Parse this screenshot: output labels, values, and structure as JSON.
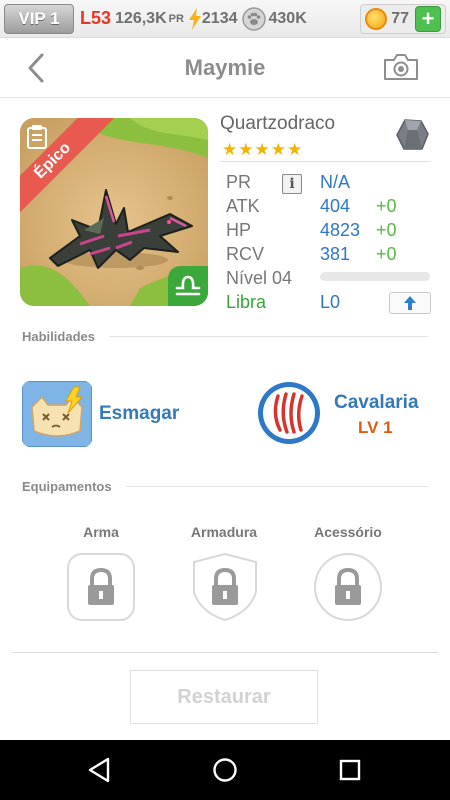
{
  "status": {
    "vip": "VIP 1",
    "level": "L53",
    "pr_value": "126,3K",
    "pr_label": "PR",
    "energy": "2134",
    "food": "430K",
    "coins": "77",
    "plus": "+"
  },
  "header": {
    "title": "Maymie"
  },
  "monster": {
    "rarity": "Épico",
    "species": "Quartzodraco",
    "stars": "★★★★★",
    "star_count": 5,
    "stats": [
      {
        "key": "PR",
        "value": "N/A",
        "bonus": ""
      },
      {
        "key": "ATK",
        "value": "404",
        "bonus": "+0"
      },
      {
        "key": "HP",
        "value": "4823",
        "bonus": "+0"
      },
      {
        "key": "RCV",
        "value": "381",
        "bonus": "+0"
      }
    ],
    "info_glyph": "i",
    "level_label": "Nível 04",
    "level_progress": 0,
    "zodiac": "Libra",
    "league": "L0"
  },
  "sections": {
    "skills": "Habilidades",
    "equipment": "Equipamentos"
  },
  "skills": {
    "active": {
      "name": "Esmagar"
    },
    "leader": {
      "name": "Cavalaria",
      "level": "LV 1"
    }
  },
  "equipment": {
    "slots": [
      {
        "label": "Arma"
      },
      {
        "label": "Armadura"
      },
      {
        "label": "Acessório"
      }
    ]
  },
  "restore_button": "Restaurar",
  "colors": {
    "stat_value": "#2d78c7",
    "bonus": "#58b948",
    "skill_name": "#3579b9",
    "leader_level": "#e05a10"
  }
}
